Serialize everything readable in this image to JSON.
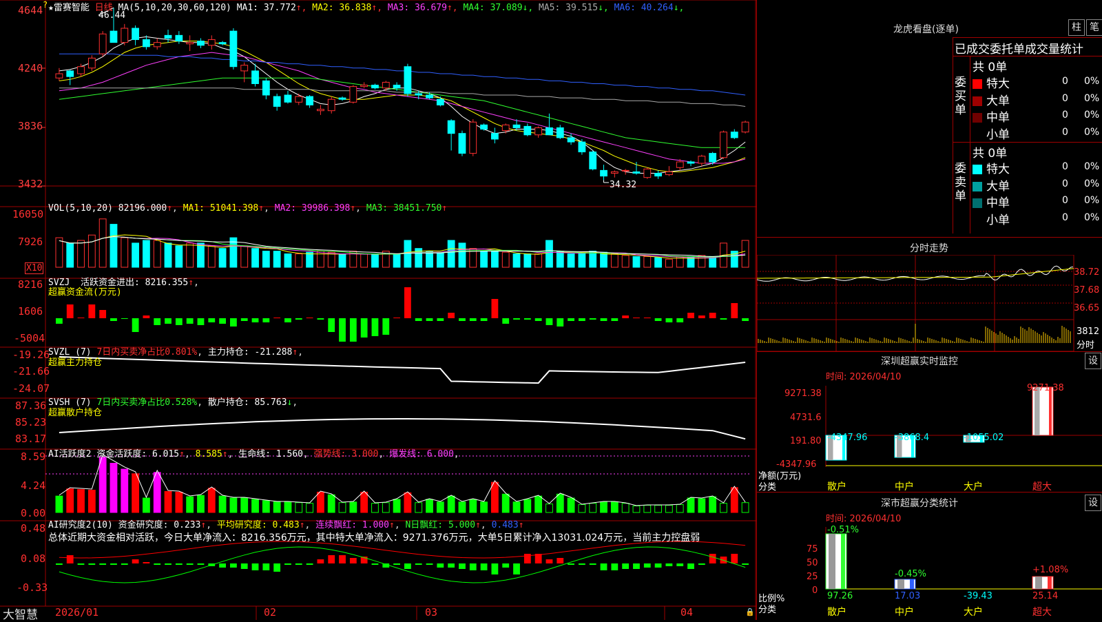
{
  "stock": {
    "name": "★雷赛智能",
    "period": "日线",
    "ma_title": "MA(5,10,20,30,60,120)",
    "ma": [
      {
        "label": "MA1: 37.772",
        "arrow": "↑",
        "color": "#ffffff"
      },
      {
        "label": "MA2: 36.838",
        "arrow": "↑",
        "color": "#ffff00"
      },
      {
        "label": "MA3: 36.679",
        "arrow": "↑",
        "color": "#ff40ff"
      },
      {
        "label": "MA4: 37.089",
        "arrow": "↓",
        "color": "#30ff30"
      },
      {
        "label": "MA5: 39.515",
        "arrow": "↓",
        "color": "#aaaaaa"
      },
      {
        "label": "MA6: 40.264",
        "arrow": "↓",
        "color": "#3060ff"
      }
    ],
    "high_label": "46.44",
    "low_label": "34.32",
    "price_axis": [
      "4644",
      "4240",
      "3836",
      "3432"
    ],
    "candles": [
      [
        41.5,
        42.2,
        41.3,
        41.8
      ],
      [
        42.0,
        42.1,
        41.0,
        41.6
      ],
      [
        41.8,
        42.5,
        41.6,
        42.3
      ],
      [
        42.2,
        43.1,
        42.0,
        42.9
      ],
      [
        43.2,
        44.8,
        43.0,
        44.6
      ],
      [
        44.8,
        46.44,
        44.2,
        44.0
      ],
      [
        44.0,
        45.3,
        43.8,
        45.0
      ],
      [
        45.0,
        45.2,
        43.8,
        44.2
      ],
      [
        44.2,
        44.5,
        43.5,
        43.7
      ],
      [
        43.7,
        44.3,
        43.5,
        44.0
      ],
      [
        44.5,
        44.9,
        44.0,
        44.3
      ],
      [
        44.5,
        44.8,
        43.9,
        44.1
      ],
      [
        43.9,
        44.5,
        43.4,
        44.0
      ],
      [
        44.1,
        44.3,
        43.6,
        43.8
      ],
      [
        43.8,
        44.5,
        43.5,
        44.2
      ],
      [
        44.0,
        44.1,
        43.8,
        43.9
      ],
      [
        44.8,
        45.0,
        42.1,
        42.3
      ],
      [
        42.0,
        42.6,
        41.2,
        42.4
      ],
      [
        42.0,
        42.5,
        40.9,
        41.1
      ],
      [
        41.3,
        41.5,
        40.0,
        40.3
      ],
      [
        40.2,
        40.4,
        39.2,
        39.5
      ],
      [
        40.3,
        40.6,
        39.7,
        39.8
      ],
      [
        39.8,
        40.4,
        39.6,
        40.2
      ],
      [
        40.2,
        40.3,
        39.4,
        39.6
      ],
      [
        39.2,
        39.6,
        38.9,
        39.3
      ],
      [
        39.2,
        40.2,
        39.0,
        40.0
      ],
      [
        40.1,
        40.2,
        39.9,
        40.0
      ],
      [
        39.8,
        41.0,
        39.7,
        40.9
      ],
      [
        40.9,
        41.2,
        40.8,
        41.0
      ],
      [
        41.0,
        41.1,
        40.7,
        40.8
      ],
      [
        40.8,
        41.3,
        40.6,
        41.2
      ],
      [
        41.0,
        41.2,
        40.6,
        40.8
      ],
      [
        42.3,
        42.5,
        40.2,
        40.4
      ],
      [
        40.4,
        40.6,
        40.0,
        40.3
      ],
      [
        40.3,
        40.5,
        40.0,
        40.1
      ],
      [
        40.0,
        40.2,
        39.5,
        39.6
      ],
      [
        38.5,
        38.6,
        36.4,
        37.6
      ],
      [
        37.6,
        37.8,
        36.0,
        36.2
      ],
      [
        36.2,
        38.6,
        36.0,
        38.4
      ],
      [
        38.2,
        38.3,
        37.8,
        37.9
      ],
      [
        37.6,
        38.0,
        36.9,
        37.2
      ],
      [
        37.8,
        38.3,
        37.6,
        38.2
      ],
      [
        38.2,
        38.6,
        37.8,
        38.0
      ],
      [
        38.1,
        38.3,
        37.4,
        37.5
      ],
      [
        37.5,
        38.1,
        37.3,
        38.0
      ],
      [
        38.0,
        39.0,
        37.6,
        37.5
      ],
      [
        38.0,
        38.2,
        37.2,
        37.3
      ],
      [
        37.3,
        37.6,
        36.8,
        37.0
      ],
      [
        37.0,
        37.2,
        36.1,
        36.3
      ],
      [
        36.3,
        36.4,
        35.0,
        35.1
      ],
      [
        35.0,
        35.4,
        34.32,
        34.6
      ],
      [
        34.8,
        35.0,
        34.5,
        34.9
      ],
      [
        35.0,
        35.1,
        34.7,
        35.0
      ],
      [
        34.9,
        35.6,
        34.7,
        34.8
      ],
      [
        34.5,
        35.2,
        34.4,
        35.1
      ],
      [
        34.8,
        35.0,
        34.4,
        34.6
      ],
      [
        34.7,
        35.3,
        34.6,
        34.9
      ],
      [
        35.2,
        35.8,
        35.0,
        35.6
      ],
      [
        35.6,
        35.7,
        35.3,
        35.5
      ],
      [
        35.5,
        36.1,
        35.3,
        36.0
      ],
      [
        36.2,
        36.3,
        35.4,
        35.6
      ],
      [
        35.9,
        37.8,
        35.8,
        37.7
      ],
      [
        37.7,
        37.9,
        37.2,
        37.3
      ],
      [
        37.7,
        38.5,
        37.6,
        38.4
      ]
    ],
    "ma_lines": [
      {
        "color": "#ffffff",
        "pts": [
          42.0,
          42.1,
          42.3,
          42.6,
          43.0,
          43.6,
          44.0,
          44.3,
          44.4,
          44.3,
          44.2,
          44.1,
          44.0,
          44.0,
          43.9,
          43.6,
          43.4,
          43.0,
          42.4,
          41.8,
          41.2,
          40.7,
          40.3,
          40.0,
          39.7,
          39.6,
          39.7,
          39.9,
          40.2,
          40.4,
          40.7,
          40.8,
          40.8,
          40.6,
          40.4,
          40.1,
          39.5,
          38.8,
          38.3,
          37.9,
          37.6,
          37.7,
          37.9,
          37.9,
          37.9,
          37.8,
          37.6,
          37.4,
          37.0,
          36.4,
          35.7,
          35.2,
          34.9,
          34.8,
          34.8,
          34.8,
          34.9,
          35.0,
          35.1,
          35.3,
          35.5,
          35.9,
          36.4,
          37.0
        ]
      },
      {
        "color": "#ffff00",
        "pts": [
          41.3,
          41.4,
          41.6,
          41.9,
          42.3,
          42.8,
          43.3,
          43.6,
          43.8,
          43.9,
          44.0,
          44.1,
          44.1,
          44.1,
          44.0,
          43.9,
          43.7,
          43.4,
          43.0,
          42.6,
          42.1,
          41.6,
          41.1,
          40.7,
          40.4,
          40.2,
          40.0,
          40.0,
          40.0,
          40.1,
          40.2,
          40.3,
          40.3,
          40.3,
          40.2,
          40.1,
          39.9,
          39.5,
          39.1,
          38.7,
          38.3,
          38.0,
          37.8,
          37.7,
          37.6,
          37.5,
          37.4,
          37.2,
          37.0,
          36.7,
          36.4,
          36.0,
          35.7,
          35.4,
          35.2,
          35.0,
          34.9,
          34.9,
          35.0,
          35.1,
          35.2,
          35.4,
          35.6,
          35.9
        ]
      },
      {
        "color": "#ff40ff",
        "pts": [
          40.6,
          40.7,
          40.8,
          41.0,
          41.2,
          41.5,
          41.8,
          42.1,
          42.4,
          42.6,
          42.8,
          43.0,
          43.1,
          43.2,
          43.3,
          43.2,
          43.1,
          43.0,
          42.8,
          42.6,
          42.4,
          42.2,
          42.0,
          41.7,
          41.4,
          41.2,
          41.0,
          40.8,
          40.7,
          40.5,
          40.4,
          40.3,
          40.2,
          40.1,
          40.0,
          39.9,
          39.7,
          39.5,
          39.3,
          39.1,
          38.9,
          38.7,
          38.5,
          38.4,
          38.2,
          38.0,
          37.8,
          37.6,
          37.4,
          37.2,
          37.0,
          36.8,
          36.6,
          36.4,
          36.2,
          36.0,
          35.8,
          35.7,
          35.6,
          35.5,
          35.5,
          35.5,
          35.6,
          35.8
        ]
      },
      {
        "color": "#30ff30",
        "pts": [
          40.0,
          40.1,
          40.2,
          40.3,
          40.4,
          40.5,
          40.6,
          40.7,
          40.8,
          40.9,
          41.0,
          41.1,
          41.2,
          41.3,
          41.4,
          41.5,
          41.5,
          41.5,
          41.5,
          41.5,
          41.5,
          41.5,
          41.5,
          41.5,
          41.4,
          41.3,
          41.2,
          41.1,
          41.0,
          40.9,
          40.8,
          40.7,
          40.6,
          40.5,
          40.4,
          40.3,
          40.2,
          40.1,
          40.0,
          39.9,
          39.7,
          39.5,
          39.3,
          39.1,
          38.9,
          38.7,
          38.5,
          38.3,
          38.1,
          37.9,
          37.7,
          37.5,
          37.3,
          37.2,
          37.1,
          37.0,
          36.9,
          36.8,
          36.7,
          36.6,
          36.6,
          36.6,
          36.6,
          36.6
        ]
      },
      {
        "color": "#aaaaaa",
        "pts": [
          40.8,
          40.8,
          40.8,
          40.8,
          40.8,
          40.8,
          40.8,
          40.8,
          40.8,
          40.8,
          40.8,
          40.8,
          40.8,
          40.8,
          40.8,
          40.8,
          40.8,
          40.7,
          40.7,
          40.7,
          40.7,
          40.7,
          40.7,
          40.7,
          40.6,
          40.6,
          40.6,
          40.6,
          40.6,
          40.6,
          40.6,
          40.5,
          40.5,
          40.5,
          40.5,
          40.5,
          40.4,
          40.4,
          40.4,
          40.3,
          40.3,
          40.3,
          40.3,
          40.2,
          40.2,
          40.2,
          40.1,
          40.1,
          40.1,
          40.0,
          40.0,
          40.0,
          39.9,
          39.9,
          39.9,
          39.8,
          39.8,
          39.8,
          39.7,
          39.7,
          39.7,
          39.6,
          39.6,
          39.5
        ]
      },
      {
        "color": "#3060ff",
        "pts": [
          43.2,
          43.2,
          43.2,
          43.2,
          43.2,
          43.2,
          43.1,
          43.1,
          43.1,
          43.1,
          43.0,
          43.0,
          43.0,
          42.9,
          42.9,
          42.8,
          42.8,
          42.7,
          42.7,
          42.6,
          42.6,
          42.5,
          42.5,
          42.4,
          42.4,
          42.3,
          42.3,
          42.2,
          42.2,
          42.1,
          42.1,
          42.0,
          42.0,
          41.9,
          41.9,
          41.8,
          41.8,
          41.7,
          41.7,
          41.6,
          41.6,
          41.5,
          41.5,
          41.4,
          41.4,
          41.3,
          41.3,
          41.2,
          41.2,
          41.1,
          41.1,
          41.0,
          41.0,
          40.9,
          40.9,
          40.8,
          40.8,
          40.7,
          40.7,
          40.6,
          40.6,
          40.5,
          40.4,
          40.3
        ]
      }
    ]
  },
  "vol": {
    "title": "VOL(5,10,20)",
    "main": "82196.000",
    "ma1": "MA1: 51041.398",
    "ma2": "MA2: 39986.398",
    "ma3": "MA3: 38451.750",
    "axis": [
      "16050",
      "7926"
    ],
    "x10": "X10"
  },
  "svzj": {
    "title": "SVZJ",
    "l1": "活跃资金进出: 8216.355",
    "l2": "超赢资金流(万元)",
    "axis": [
      "8216",
      "1606",
      "-5004"
    ]
  },
  "svzl": {
    "title": "SVZL (7)",
    "l1": "7日内买卖净占比0.801%",
    "l2": "主力持仓: -21.288",
    "sub": "超赢主力持仓",
    "axis": [
      "-19.26",
      "-21.66",
      "-24.07"
    ]
  },
  "svsh": {
    "title": "SVSH (7)",
    "l1": "7日内买卖净占比0.528%",
    "l2": "散户持仓: 85.763",
    "sub": "超赢散户持仓",
    "axis": [
      "87.36",
      "85.23",
      "83.17"
    ]
  },
  "ai2": {
    "title": "AI活跃度2",
    "v1": "资金活跃度: 6.015",
    "v2": "8.585",
    "v3": "生命线: 1.560",
    "v4": "强势线: 3.000",
    "v5": "爆发线: 6.000",
    "axis": [
      "8.59",
      "4.24",
      "0.00"
    ]
  },
  "ai_res": {
    "title": "AI研究度2(10)",
    "v1": "资金研究度: 0.233",
    "v2": "平均研究度: 0.483",
    "v3": "连续飘红: 1.000",
    "v4": "N日飘红: 5.000",
    "v5": "0.483",
    "summary": "总体近期大资金相对活跃，今日大单净流入：8216.356万元，其中特大单净流入：9271.376万元，大单5日累计净入13031.024万元，当前主力控盘弱",
    "axis": [
      "0.48",
      "0.08",
      "-0.33"
    ]
  },
  "xaxis": [
    "2026/01",
    "02",
    "03",
    "04"
  ],
  "brand": "大智慧",
  "right": {
    "dragon_title": "龙虎看盘(逐单)",
    "tab_zhu": "柱",
    "tab_bi": "笔",
    "order_stats": "已成交委托单成交量统计",
    "buy_label": "委买单",
    "sell_label": "委卖单",
    "buy_total": "共 0单",
    "sell_total": "共 0单",
    "buy_rows": [
      {
        "name": "特大",
        "v": "0",
        "p": "0%",
        "color": "#ff0000"
      },
      {
        "name": "大单",
        "v": "0",
        "p": "0%",
        "color": "#a00000"
      },
      {
        "name": "中单",
        "v": "0",
        "p": "0%",
        "color": "#700000"
      },
      {
        "name": "小单",
        "v": "0",
        "p": "0%",
        "color": "#000000"
      }
    ],
    "sell_rows": [
      {
        "name": "特大",
        "v": "0",
        "p": "0%",
        "color": "#00ffff"
      },
      {
        "name": "大单",
        "v": "0",
        "p": "0%",
        "color": "#00a0a0"
      },
      {
        "name": "中单",
        "v": "0",
        "p": "0%",
        "color": "#007070"
      },
      {
        "name": "小单",
        "v": "0",
        "p": "0%",
        "color": "#000000"
      }
    ],
    "intraday_title": "分时走势",
    "intraday_axis": [
      "38.72",
      "37.68",
      "36.65"
    ],
    "intraday_vol": "3812",
    "intraday_vol_unit": "分时",
    "sz_title": "深圳超赢实时监控",
    "sz_set": "设",
    "sz_time": "时间: 2026/04/10",
    "sz_axis": [
      "9271.38",
      "4731.6",
      "191.80",
      "-4347.96"
    ],
    "sz_top": "9271.38",
    "sz_net": "净额(万元)",
    "sz_cat": "分类",
    "sz_vals": [
      "-4347.96",
      "-3868.4",
      "-1055.02"
    ],
    "sz_cats": [
      "散户",
      "中户",
      "大户",
      "超大"
    ],
    "stat_title": "深市超赢分类统计",
    "stat_set": "设",
    "stat_time": "时间: 2026/04/10",
    "stat_axis": [
      "75",
      "50",
      "25",
      "0"
    ],
    "stat_ratio": "比例%",
    "stat_cat": "分类",
    "stat_top": [
      "-0.51%",
      "-0.45%",
      "+1.08%"
    ],
    "stat_bottom": [
      "97.26",
      "17.03",
      "-39.43",
      "25.14"
    ],
    "stat_cats": [
      "散户",
      "中户",
      "大户",
      "超大"
    ]
  }
}
